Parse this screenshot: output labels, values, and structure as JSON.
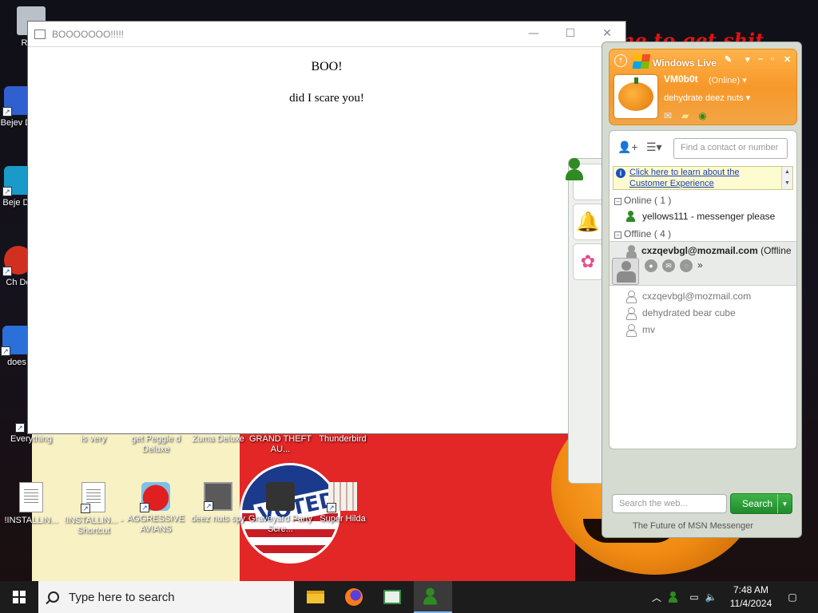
{
  "desktop": {
    "wallpaper_text": "ime to get shit",
    "voted_text": "VOTED",
    "icons": [
      {
        "label": "Recy"
      },
      {
        "label": "Bejev De"
      },
      {
        "label": "Beje De"
      },
      {
        "label": "Ch De"
      },
      {
        "label": "does"
      },
      {
        "label": "Everything"
      },
      {
        "label": "is very"
      },
      {
        "label": "get Peggle d Deluxe"
      },
      {
        "label": "Zuma Deluxe"
      },
      {
        "label": "GRAND THEFT AU..."
      },
      {
        "label": "Thunderbird"
      },
      {
        "label": "!INSTALLIN..."
      },
      {
        "label": "!INSTALLIN... - Shortcut"
      },
      {
        "label": "AGGRESSIVE AVIANS"
      },
      {
        "label": "deez nuts spy"
      },
      {
        "label": "Graveyard Party Scre..."
      },
      {
        "label": "Super Hilda"
      }
    ]
  },
  "browser_window": {
    "title": "BOOOOOOO!!!!!",
    "heading": "BOO!",
    "paragraph": "did I scare you!",
    "controls": {
      "minimize": "—",
      "maximize": "☐",
      "close": "✕"
    }
  },
  "messenger": {
    "title": "Windows Live",
    "user": {
      "name": "VM0b0t",
      "status": "(Online)",
      "personal_message": "dehydrate deez nuts"
    },
    "find_placeholder": "Find a contact or number",
    "banner_text": "Click here to learn about the Customer Experience",
    "groups": {
      "online": "Online ( 1 )",
      "offline": "Offline ( 4 )"
    },
    "online_contacts": [
      {
        "name": "yellows111 - messenger please"
      }
    ],
    "selected_contact": {
      "name": "cxzqevbgl@mozmail.com",
      "status": "(Offline"
    },
    "offline_contacts": [
      {
        "name": "cxzqevbgl@mozmail.com"
      },
      {
        "name": "dehydrated bear cube"
      },
      {
        "name": "mv"
      }
    ],
    "web_search_placeholder": "Search the web...",
    "search_button": "Search",
    "footer": "The Future of MSN Messenger"
  },
  "taskbar": {
    "search_placeholder": "Type here to search",
    "time": "7:48 AM",
    "date": "11/4/2024"
  }
}
